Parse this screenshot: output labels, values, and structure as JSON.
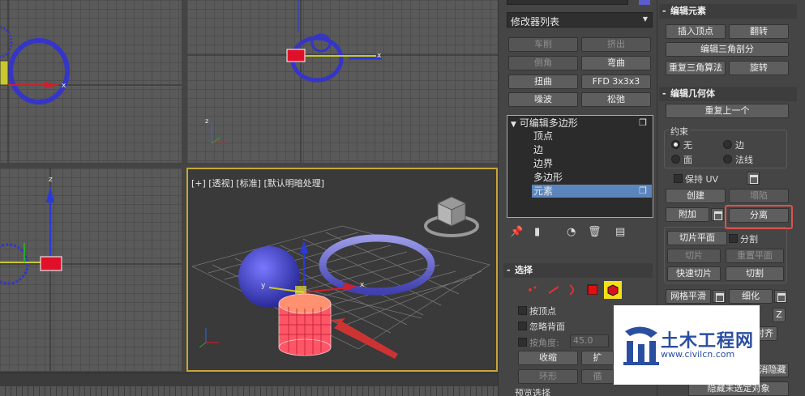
{
  "viewports": {
    "perspective_label": "[+] [透视] [标准] [默认明暗处理]",
    "axis_x": "x",
    "axis_y": "y",
    "axis_z": "z"
  },
  "modifier_panel": {
    "modifier_list": "修改器列表",
    "buttons": {
      "lathe": "车削",
      "extrude": "挤出",
      "chamfer": "倒角",
      "bend": "弯曲",
      "twist": "扭曲",
      "ffd": "FFD 3x3x3",
      "ripple": "噪波",
      "relax": "松弛"
    },
    "stack": {
      "root": "可编辑多边形",
      "vertex": "顶点",
      "edge": "边",
      "border": "边界",
      "polygon": "多边形",
      "element": "元素"
    },
    "selection": {
      "title": "选择",
      "by_vertex": "按顶点",
      "ignore_backfacing": "忽略背面",
      "by_angle": "按角度:",
      "angle_value": "45.0",
      "shrink": "收缩",
      "grow_partial": "扩",
      "ring": "环形",
      "loop_partial": "循",
      "preview": "预览选择"
    }
  },
  "edit_panel": {
    "edit_elements": {
      "title": "编辑元素",
      "insert_vertex": "插入顶点",
      "flip": "翻转",
      "edit_triangulation": "编辑三角剖分",
      "retriangulate": "重复三角算法",
      "turn": "旋转"
    },
    "edit_geometry": {
      "title": "编辑几何体",
      "repeat_last": "重复上一个",
      "constraints": "约束",
      "none": "无",
      "edge": "边",
      "face": "面",
      "normal": "法线",
      "preserve_uv": "保持 UV",
      "create": "创建",
      "collapse": "塌陷",
      "attach": "附加",
      "detach": "分离",
      "slice_plane": "切片平面",
      "split": "分割",
      "slice": "切片",
      "reset_plane": "重置平面",
      "quickslice": "快速切片",
      "cut": "切割",
      "msmooth": "网格平滑",
      "tessellate": "细化",
      "z": "Z",
      "align_partial": "对齐",
      "hide_partial": "消隐藏",
      "hide_unselected": "隐藏未选定对象"
    }
  },
  "watermark": {
    "title": "土木工程网",
    "url": "www.civilcn.com"
  },
  "colors": {
    "accent": "#5b86bd",
    "viewport_active_border": "#c9a53a",
    "highlight": "#d9544d",
    "red": "#e0102a",
    "blue_object": "#4b4bd0",
    "pink_object": "#ff5566"
  }
}
